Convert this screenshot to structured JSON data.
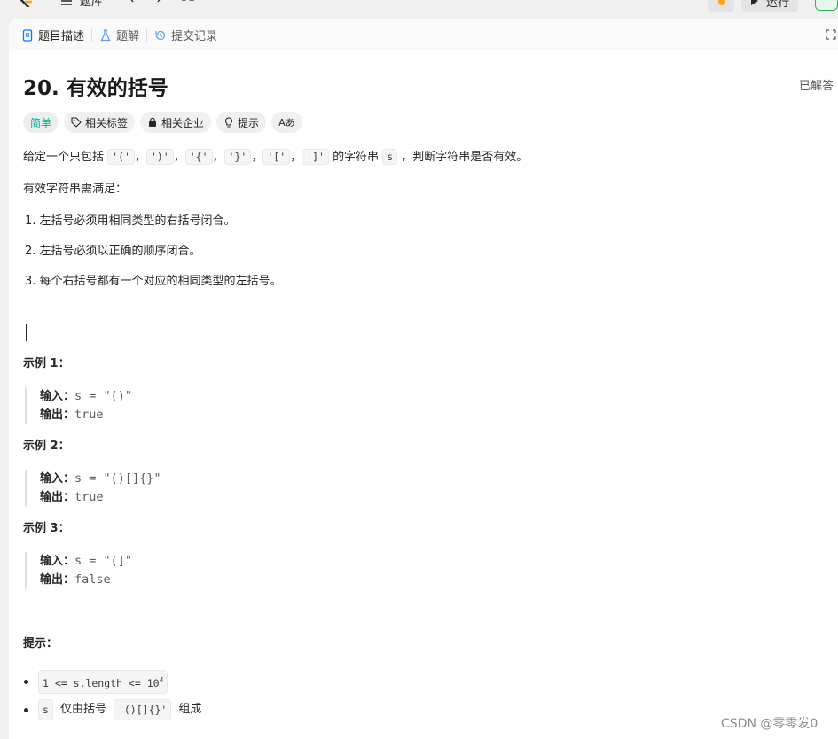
{
  "topbar": {
    "problem_bank": "题库",
    "run_label": "运行"
  },
  "tabs": [
    {
      "label": "题目描述"
    },
    {
      "label": "题解"
    },
    {
      "label": "提交记录"
    }
  ],
  "problem": {
    "title": "20. 有效的括号",
    "status": "已解答",
    "tags": {
      "difficulty": "简单",
      "related_tags": "相关标签",
      "related_companies": "相关企业",
      "hints": "提示",
      "translate": "Aあ"
    },
    "desc": {
      "pre": "给定一个只包括",
      "c1": "'('",
      "c2": "')'",
      "c3": "'{'",
      "c4": "'}'",
      "c5": "'['",
      "c6": "']'",
      "sep": "，",
      "mid": "的字符串",
      "s": "s",
      "post": "，判断字符串是否有效。"
    },
    "rule_intro": "有效字符串需满足：",
    "rules": [
      "1. 左括号必须用相同类型的右括号闭合。",
      "2. 左括号必须以正确的顺序闭合。",
      "3. 每个右括号都有一个对应的相同类型的左括号。"
    ],
    "examples": [
      {
        "title": "示例 1：",
        "input_label": "输入：",
        "input": "s = \"()\"",
        "output_label": "输出：",
        "output": "true"
      },
      {
        "title": "示例 2：",
        "input_label": "输入：",
        "input": "s = \"()[]{}\"",
        "output_label": "输出：",
        "output": "true"
      },
      {
        "title": "示例 3：",
        "input_label": "输入：",
        "input": "s = \"(]\"",
        "output_label": "输出：",
        "output": "false"
      }
    ],
    "hints_title": "提示：",
    "constraints": {
      "c1_code": "1 <= s.length <= 10",
      "c1_sup": "4",
      "c2_s": "s",
      "c2_text": "仅由括号",
      "c2_code": "'()[]{}'",
      "c2_post": "组成"
    }
  },
  "watermark": "CSDN @零零发0"
}
